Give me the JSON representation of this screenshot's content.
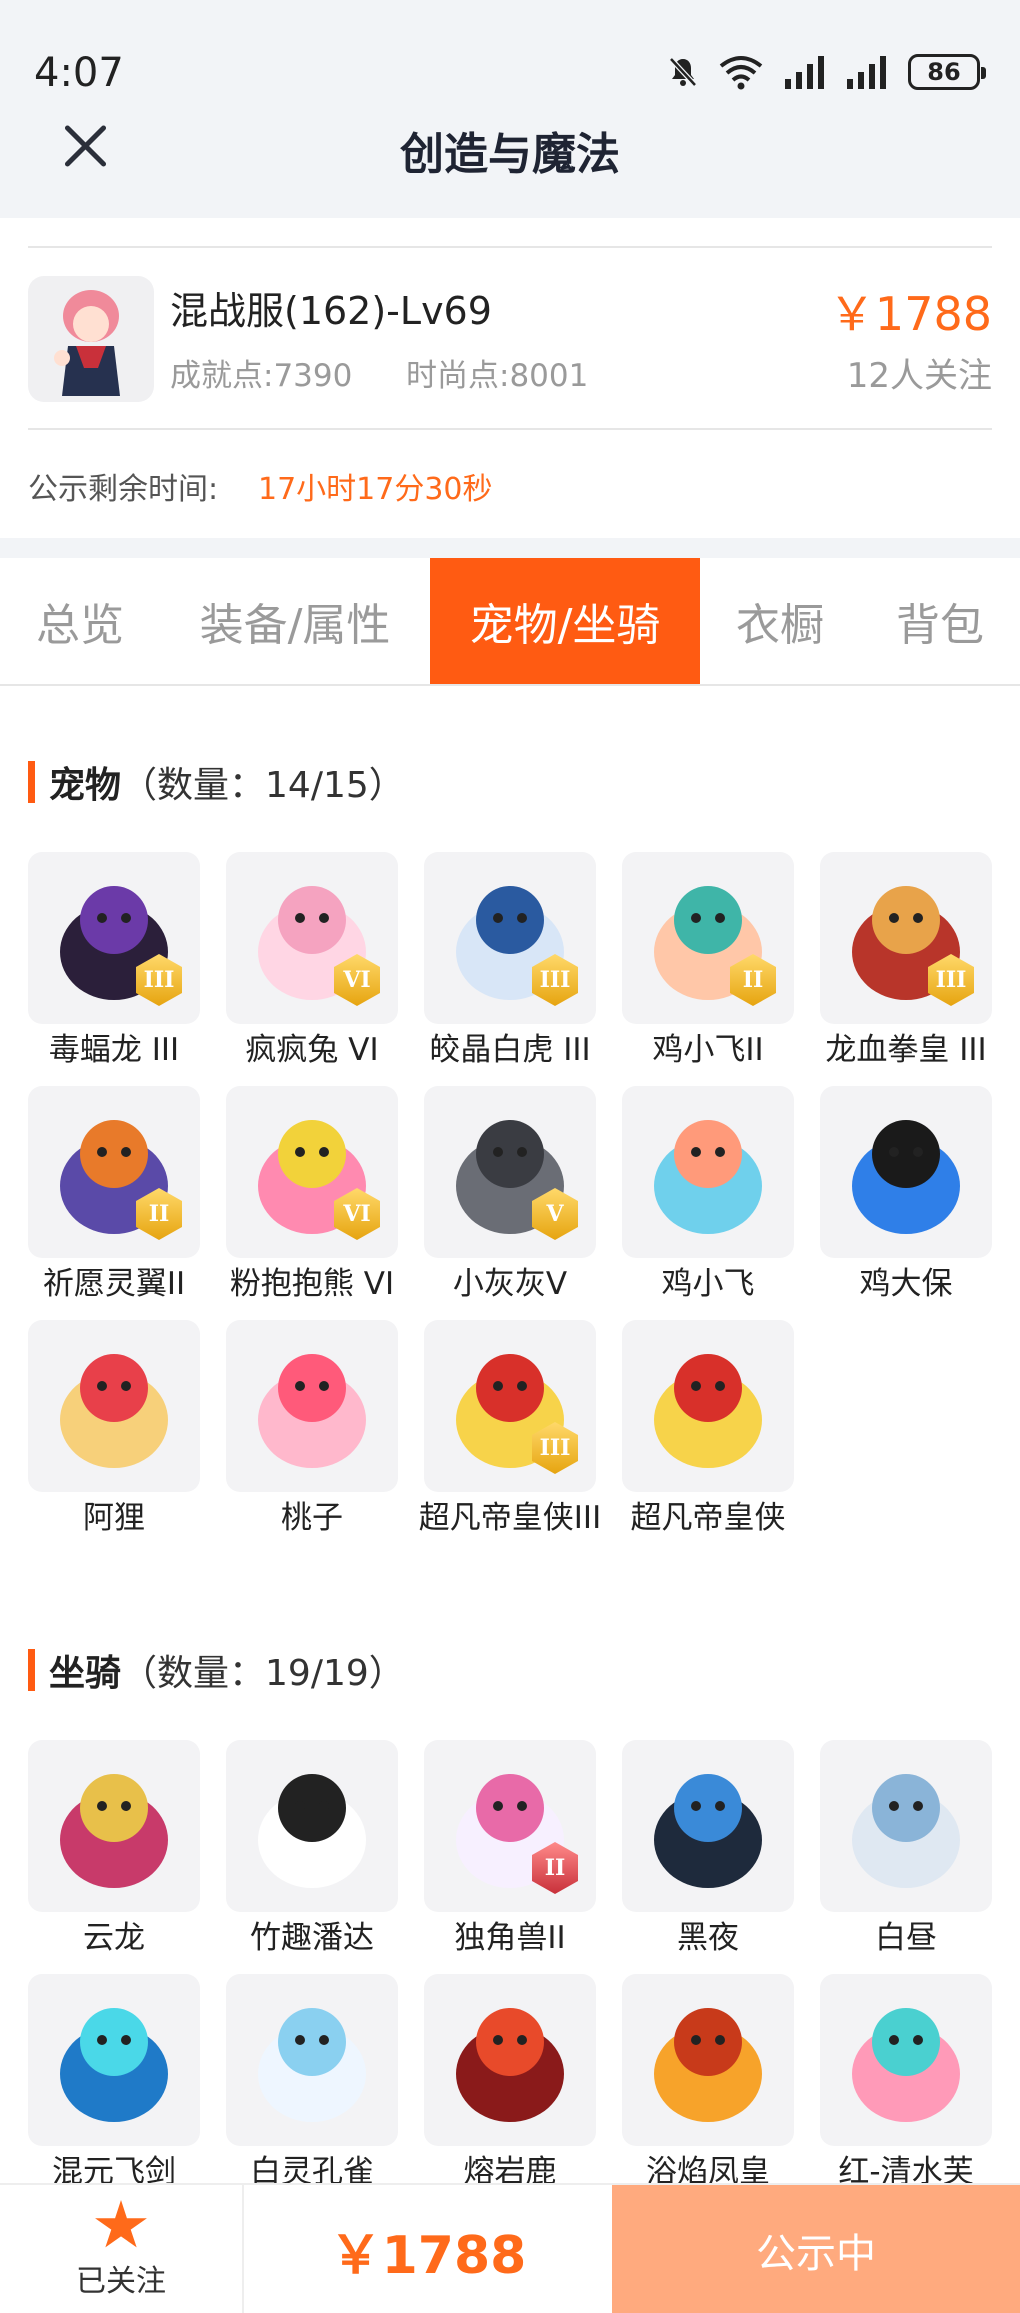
{
  "status_bar": {
    "time": "4:07",
    "battery": "86"
  },
  "header": {
    "title": "创造与魔法"
  },
  "account": {
    "server_level": "混战服(162)-Lv69",
    "achievement": "成就点:7390",
    "fashion": "时尚点:8001",
    "price": "￥1788",
    "follows": "12人关注",
    "remain_label": "公示剩余时间:",
    "remain_value": "17小时17分30秒"
  },
  "tabs": [
    {
      "label": "总览"
    },
    {
      "label": "装备/属性"
    },
    {
      "label": "宠物/坐骑",
      "active": true
    },
    {
      "label": "衣橱"
    },
    {
      "label": "背包"
    }
  ],
  "pets": {
    "title": "宠物",
    "count": "（数量：14/15）",
    "items": [
      {
        "name": "毒蝠龙 III",
        "icon": "dark-dragon-icon",
        "badge": "III"
      },
      {
        "name": "疯疯兔 VI",
        "icon": "pink-rabbit-icon",
        "badge": "VI"
      },
      {
        "name": "皎晶白虎 III",
        "icon": "white-tiger-icon",
        "badge": "III"
      },
      {
        "name": "鸡小飞II",
        "icon": "muscle-chick-icon",
        "badge": "II"
      },
      {
        "name": "龙血拳皇 III",
        "icon": "red-ram-icon",
        "badge": "III"
      },
      {
        "name": "祈愿灵翼II",
        "icon": "eagle-icon",
        "badge": "II"
      },
      {
        "name": "粉抱抱熊 VI",
        "icon": "pink-bear-icon",
        "badge": "VI"
      },
      {
        "name": "小灰灰V",
        "icon": "grey-wolf-icon",
        "badge": "V"
      },
      {
        "name": "鸡小飞",
        "icon": "blue-chick-icon",
        "badge": ""
      },
      {
        "name": "鸡大保",
        "icon": "blue-bird-sunglasses-icon",
        "badge": ""
      },
      {
        "name": "阿狸",
        "icon": "lion-hat-icon",
        "badge": ""
      },
      {
        "name": "桃子",
        "icon": "pink-fox-icon",
        "badge": ""
      },
      {
        "name": "超凡帝皇侠III",
        "icon": "golden-armor-icon",
        "badge": "III"
      },
      {
        "name": "超凡帝皇侠",
        "icon": "golden-armor-icon",
        "badge": ""
      }
    ]
  },
  "mounts": {
    "title": "坐骑",
    "count": "（数量：19/19）",
    "items": [
      {
        "name": "云龙",
        "icon": "cloud-dragon-icon",
        "badge": ""
      },
      {
        "name": "竹趣潘达",
        "icon": "panda-icon",
        "badge": ""
      },
      {
        "name": "独角兽II",
        "icon": "unicorn-icon",
        "badge": "II"
      },
      {
        "name": "黑夜",
        "icon": "night-dragon-icon",
        "badge": ""
      },
      {
        "name": "白昼",
        "icon": "day-dragon-icon",
        "badge": ""
      },
      {
        "name": "混元飞剑",
        "icon": "flying-sword-icon",
        "badge": ""
      },
      {
        "name": "白灵孔雀",
        "icon": "white-peacock-icon",
        "badge": ""
      },
      {
        "name": "熔岩鹿",
        "icon": "lava-deer-icon",
        "badge": ""
      },
      {
        "name": "浴焰凤皇",
        "icon": "phoenix-icon",
        "badge": ""
      },
      {
        "name": "红-清水芙",
        "icon": "lotus-icon",
        "badge": ""
      }
    ]
  },
  "bottom_bar": {
    "follow_label": "已关注",
    "price": "￥1788",
    "status": "公示中"
  },
  "colors": {
    "accent": "#ff5b12",
    "price": "#ff6a1a",
    "status_button": "#ffaa7e"
  }
}
